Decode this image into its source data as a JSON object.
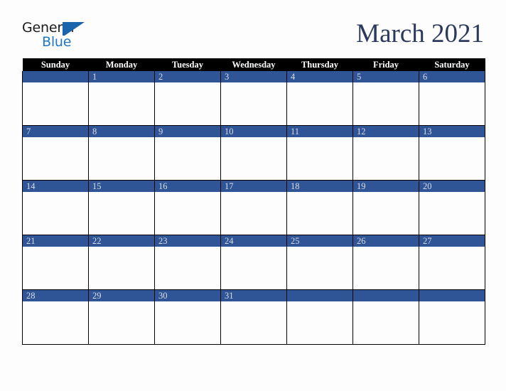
{
  "brand": {
    "logo_text_top": "General",
    "logo_text_bottom": "Blue",
    "logo_color_dark": "#1b1b1b",
    "logo_color_blue": "#1f77c4",
    "logo_triangle_color": "#1a63ad"
  },
  "header": {
    "title": "March 2021",
    "title_color": "#2b3a5c"
  },
  "calendar": {
    "month": "March",
    "year": "2021",
    "header_background": "#000000",
    "header_text_color": "#ffffff",
    "daynum_background": "#2f5597",
    "daynum_text_color": "#d9dde8",
    "cell_background": "#fdfdfd",
    "grid_line_color": "#000000",
    "weekday_headers": [
      "Sunday",
      "Monday",
      "Tuesday",
      "Wednesday",
      "Thursday",
      "Friday",
      "Saturday"
    ],
    "weeks": [
      [
        "",
        "1",
        "2",
        "3",
        "4",
        "5",
        "6"
      ],
      [
        "7",
        "8",
        "9",
        "10",
        "11",
        "12",
        "13"
      ],
      [
        "14",
        "15",
        "16",
        "17",
        "18",
        "19",
        "20"
      ],
      [
        "21",
        "22",
        "23",
        "24",
        "25",
        "26",
        "27"
      ],
      [
        "28",
        "29",
        "30",
        "31",
        "",
        "",
        ""
      ]
    ]
  }
}
